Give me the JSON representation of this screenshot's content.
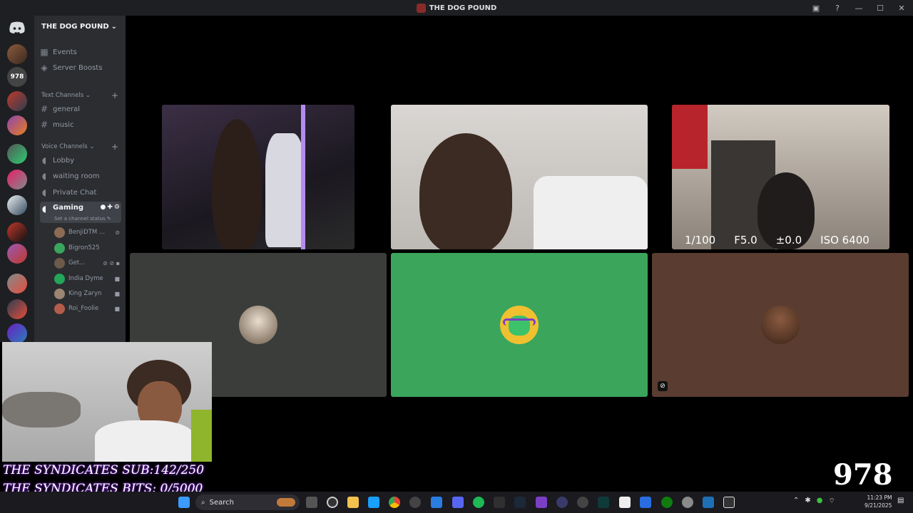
{
  "window": {
    "title": "THE DOG POUND"
  },
  "guild": {
    "name": "THE DOG POUND"
  },
  "sidebar": {
    "top_items": [
      {
        "label": "Events",
        "icon": "calendar-icon"
      },
      {
        "label": "Server Boosts",
        "icon": "boost-icon"
      }
    ],
    "text_category": "Text Channels",
    "text_channels": [
      "general",
      "music"
    ],
    "voice_category": "Voice Channels",
    "voice_channels": [
      "Lobby",
      "waiting room",
      "Private Chat",
      "Gaming"
    ],
    "channel_status_hint": "Set a channel status",
    "members": [
      {
        "name": "BenjiDTM ...",
        "color": "#8c6b55"
      },
      {
        "name": "Bigron525",
        "color": "#3aa55d"
      },
      {
        "name": "Get...",
        "color": "#6d5a4b"
      },
      {
        "name": "India Dyme",
        "color": "#23a55a"
      },
      {
        "name": "King Zaryn",
        "color": "#9b8573"
      },
      {
        "name": "Roi_Foolie",
        "color": "#b35c4a"
      }
    ]
  },
  "camera_readout": {
    "shutter": "1/100",
    "aperture": "F5.0",
    "exposure": "±0.0",
    "iso": "ISO 6400"
  },
  "overlay": {
    "sub_goal": "THE SYNDICATES SUB:142/250",
    "bits_goal": "THE SYNDICATES BITS: 0/5000"
  },
  "logo_text": "978",
  "rail_logo_text": "978",
  "taskbar": {
    "search_placeholder": "Search"
  },
  "clock": {
    "time": "11:23 PM",
    "date": "9/21/2025"
  },
  "colors": {
    "green_tile": "#3ba55c",
    "brown_tile": "#5a3c30",
    "gray_tile": "#3a3d3a",
    "sidebar": "#2b2d31",
    "rail": "#1e1f22"
  }
}
